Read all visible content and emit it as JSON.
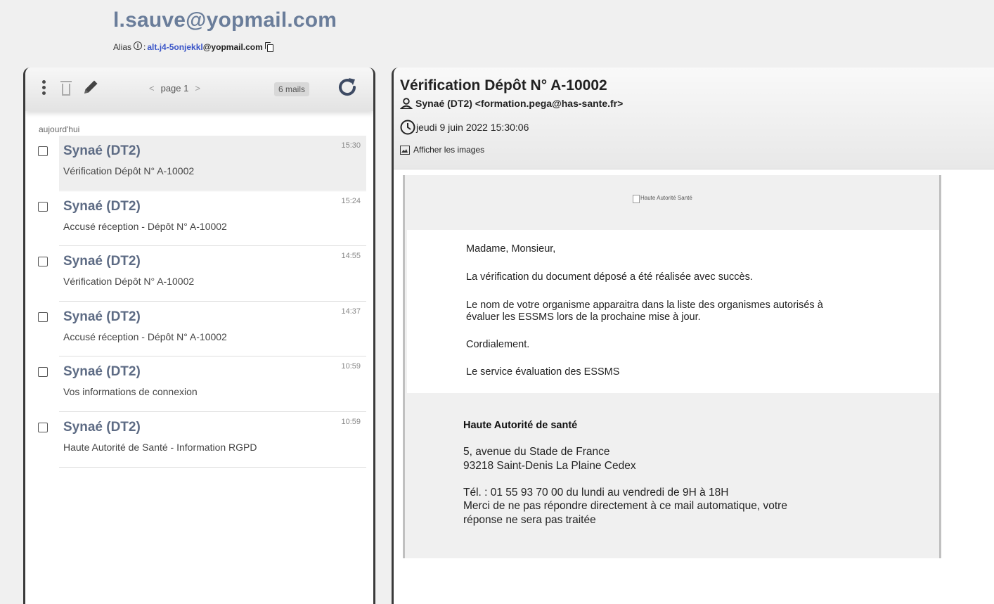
{
  "header": {
    "inbox_email": "l.sauve@yopmail.com",
    "alias_label": "Alias",
    "alias_separator": ":",
    "alias_name": "alt.j4-5onjekkl",
    "alias_domain": "@yopmail.com"
  },
  "toolbar": {
    "page_label": "page 1",
    "prev_arrow": "<",
    "next_arrow": ">",
    "mail_count": "6 mails"
  },
  "list": {
    "group_label": "aujourd'hui",
    "items": [
      {
        "sender": "Synaé (DT2)",
        "subject": "Vérification Dépôt N° A-10002",
        "time": "15:30"
      },
      {
        "sender": "Synaé (DT2)",
        "subject": "Accusé réception - Dépôt N° A-10002",
        "time": "15:24"
      },
      {
        "sender": "Synaé (DT2)",
        "subject": "Vérification Dépôt N° A-10002",
        "time": "14:55"
      },
      {
        "sender": "Synaé (DT2)",
        "subject": "Accusé réception - Dépôt N° A-10002",
        "time": "14:37"
      },
      {
        "sender": "Synaé (DT2)",
        "subject": "Vos informations de connexion",
        "time": "10:59"
      },
      {
        "sender": "Synaé (DT2)",
        "subject": "Haute Autorité de Santé - Information RGPD",
        "time": "10:59"
      }
    ]
  },
  "message": {
    "subject": "Vérification Dépôt N° A-10002",
    "from": "Synaé (DT2) <formation.pega@has-sante.fr>",
    "date": "jeudi 9 juin 2022 15:30:06",
    "show_images": "Afficher les images",
    "logo_alt": "Haute Autorité Santé",
    "greeting": "Madame, Monsieur,",
    "line1": "La vérification du document déposé a été réalisée avec succès.",
    "line2a": "Le nom de votre organisme apparaitra dans la liste des organismes autorisés à",
    "line2b": "évaluer les ESSMS lors de la prochaine mise à jour.",
    "closing": "Cordialement.",
    "signature": "Le service évaluation des ESSMS",
    "org_name": "Haute Autorité de santé",
    "address1": "5, avenue du Stade de France",
    "address2": "93218 Saint-Denis La Plaine Cedex",
    "phone": "Tél. : 01 55 93 70 00 du lundi au vendredi de 9H à 18H",
    "noreply1": "Merci de ne pas répondre directement à ce mail automatique, votre",
    "noreply2": "réponse ne sera pas traitée"
  },
  "colors": {
    "accent": "#6a7d9a",
    "alias_link": "#3a55c8",
    "sender": "#5d6b84"
  }
}
